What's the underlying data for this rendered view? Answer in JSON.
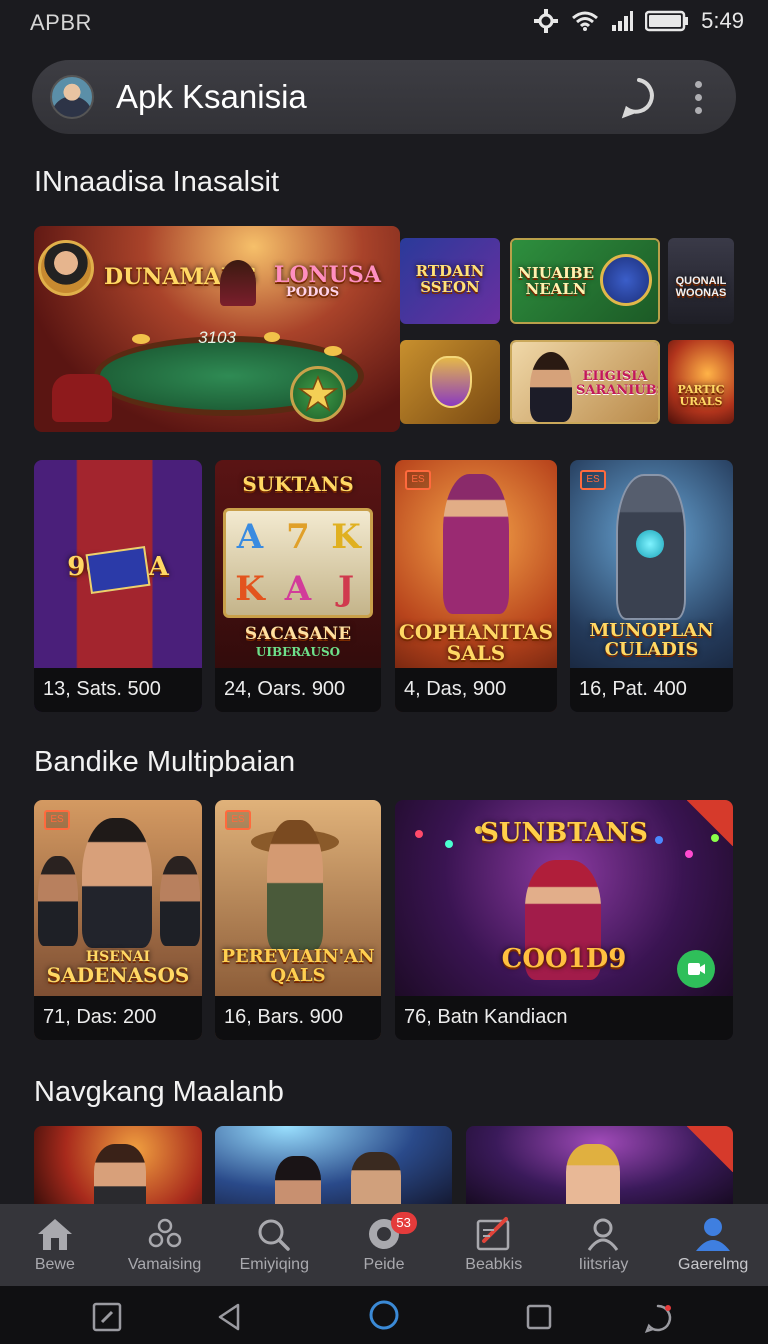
{
  "status": {
    "left_text": "APBR",
    "time": "5:49"
  },
  "search_bar": {
    "title": "Apk Ksanisia"
  },
  "sections": [
    {
      "title": "INnaadisa Inasalsit"
    },
    {
      "title": "Bandike Multipbaian"
    },
    {
      "title": "Navgkang Maalanb"
    }
  ],
  "featured": {
    "main_left_text": "DUNAMANS",
    "main_right_text": "LONUSA",
    "main_right_subtext": "PODOS",
    "table_number": "3103",
    "tiles": [
      {
        "line1": "RTDAIN",
        "line2": "SSEON"
      },
      {
        "line1": "NIUAIBE",
        "line2": "NEALN"
      },
      {
        "line1": "QUONAIL",
        "line2": "WOONAS"
      },
      {
        "line1": "",
        "line2": ""
      },
      {
        "line1": "EIIGISIA",
        "line2": "SARANIUBS"
      },
      {
        "line1": "PARTIC",
        "line2": "URALS"
      }
    ]
  },
  "row1": [
    {
      "caption": "13, Sats. 500",
      "art": "96 · 7A"
    },
    {
      "caption": "24, Oars. 900",
      "art_top": "SUKTANS",
      "art_bottom": "SACASANE",
      "art_sub": "UIBERAUSO",
      "reels": [
        "A",
        "7",
        "K",
        "K",
        "A",
        "J"
      ]
    },
    {
      "caption": "4, Das, 900",
      "art_line1": "COPHANITAS",
      "art_line2": "SALS"
    },
    {
      "caption": "16, Pat. 400",
      "art_line1": "MUNOPLAN",
      "art_line2": "CULADIS"
    }
  ],
  "row2": [
    {
      "caption": "71, Das: 200",
      "art_line1": "HSENAI",
      "art_line2": "SADENASOS"
    },
    {
      "caption": "16, Bars. 900",
      "art_line1": "PEREVIAIN'AN",
      "art_line2": "QALS"
    },
    {
      "caption": "76, Batn Kandiacn",
      "art_top": "SUNBTANS",
      "art_bottom": "COO1D9"
    }
  ],
  "bottom_nav": [
    {
      "label": "Bewe",
      "icon": "home-icon"
    },
    {
      "label": "Vamaising",
      "icon": "community-icon"
    },
    {
      "label": "Emiyiqing",
      "icon": "search-icon"
    },
    {
      "label": "Peide",
      "icon": "chat-icon",
      "badge": "53"
    },
    {
      "label": "Beabkis",
      "icon": "edit-icon"
    },
    {
      "label": "Iiitsriay",
      "icon": "person-icon"
    },
    {
      "label": "Gaerelmg",
      "icon": "profile-icon"
    }
  ],
  "colors": {
    "background": "#1b1b1f",
    "accent": "#3f7fe0",
    "badge": "#e43b3b",
    "nav_bg": "#35353a"
  }
}
